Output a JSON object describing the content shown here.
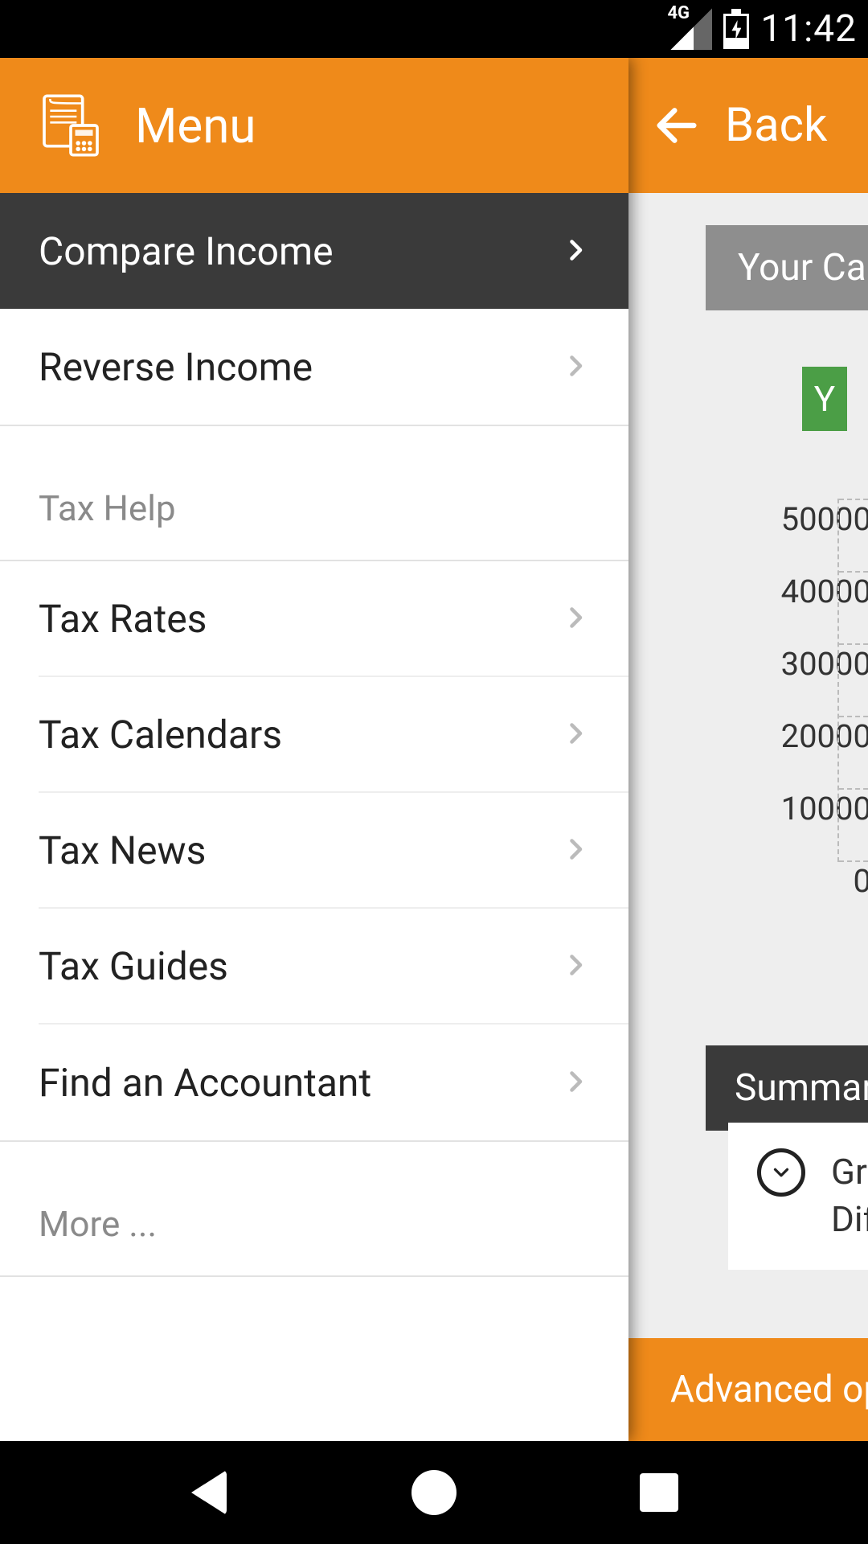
{
  "status_bar": {
    "network_type": "4G",
    "time": "11:42"
  },
  "drawer": {
    "title": "Menu",
    "top_items": [
      {
        "id": "compare-income",
        "label": "Compare Income",
        "selected": true
      },
      {
        "id": "reverse-income",
        "label": "Reverse Income",
        "selected": false
      }
    ],
    "sections": [
      {
        "id": "tax-help",
        "header": "Tax Help",
        "items": [
          {
            "id": "tax-rates",
            "label": "Tax Rates"
          },
          {
            "id": "tax-calendars",
            "label": "Tax Calendars"
          },
          {
            "id": "tax-news",
            "label": "Tax News"
          },
          {
            "id": "tax-guides",
            "label": "Tax Guides"
          },
          {
            "id": "find-accountant",
            "label": "Find an Accountant"
          }
        ]
      },
      {
        "id": "more",
        "header": "More ..."
      }
    ]
  },
  "page": {
    "back_label": "Back",
    "tab_visible_text": "Your Ca",
    "badge": "Y",
    "y_axis_ticks": [
      "50000",
      "40000",
      "30000",
      "20000",
      "10000",
      "0"
    ],
    "summary_label": "Summary",
    "summary_lines": [
      "Gro",
      "Diff"
    ],
    "advanced_label": "Advanced opt"
  },
  "chart_data": {
    "type": "bar",
    "title": "",
    "xlabel": "",
    "ylabel": "",
    "ylim": [
      0,
      50000
    ],
    "y_ticks": [
      0,
      10000,
      20000,
      30000,
      40000,
      50000
    ],
    "categories": [],
    "values": [],
    "note": "Chart area is mostly off-screen behind the drawer; only y-axis tick labels are visible."
  },
  "colors": {
    "accent": "#ef8a1a",
    "badge_green": "#4b9e46",
    "dark_chip": "#3a3a3a"
  }
}
